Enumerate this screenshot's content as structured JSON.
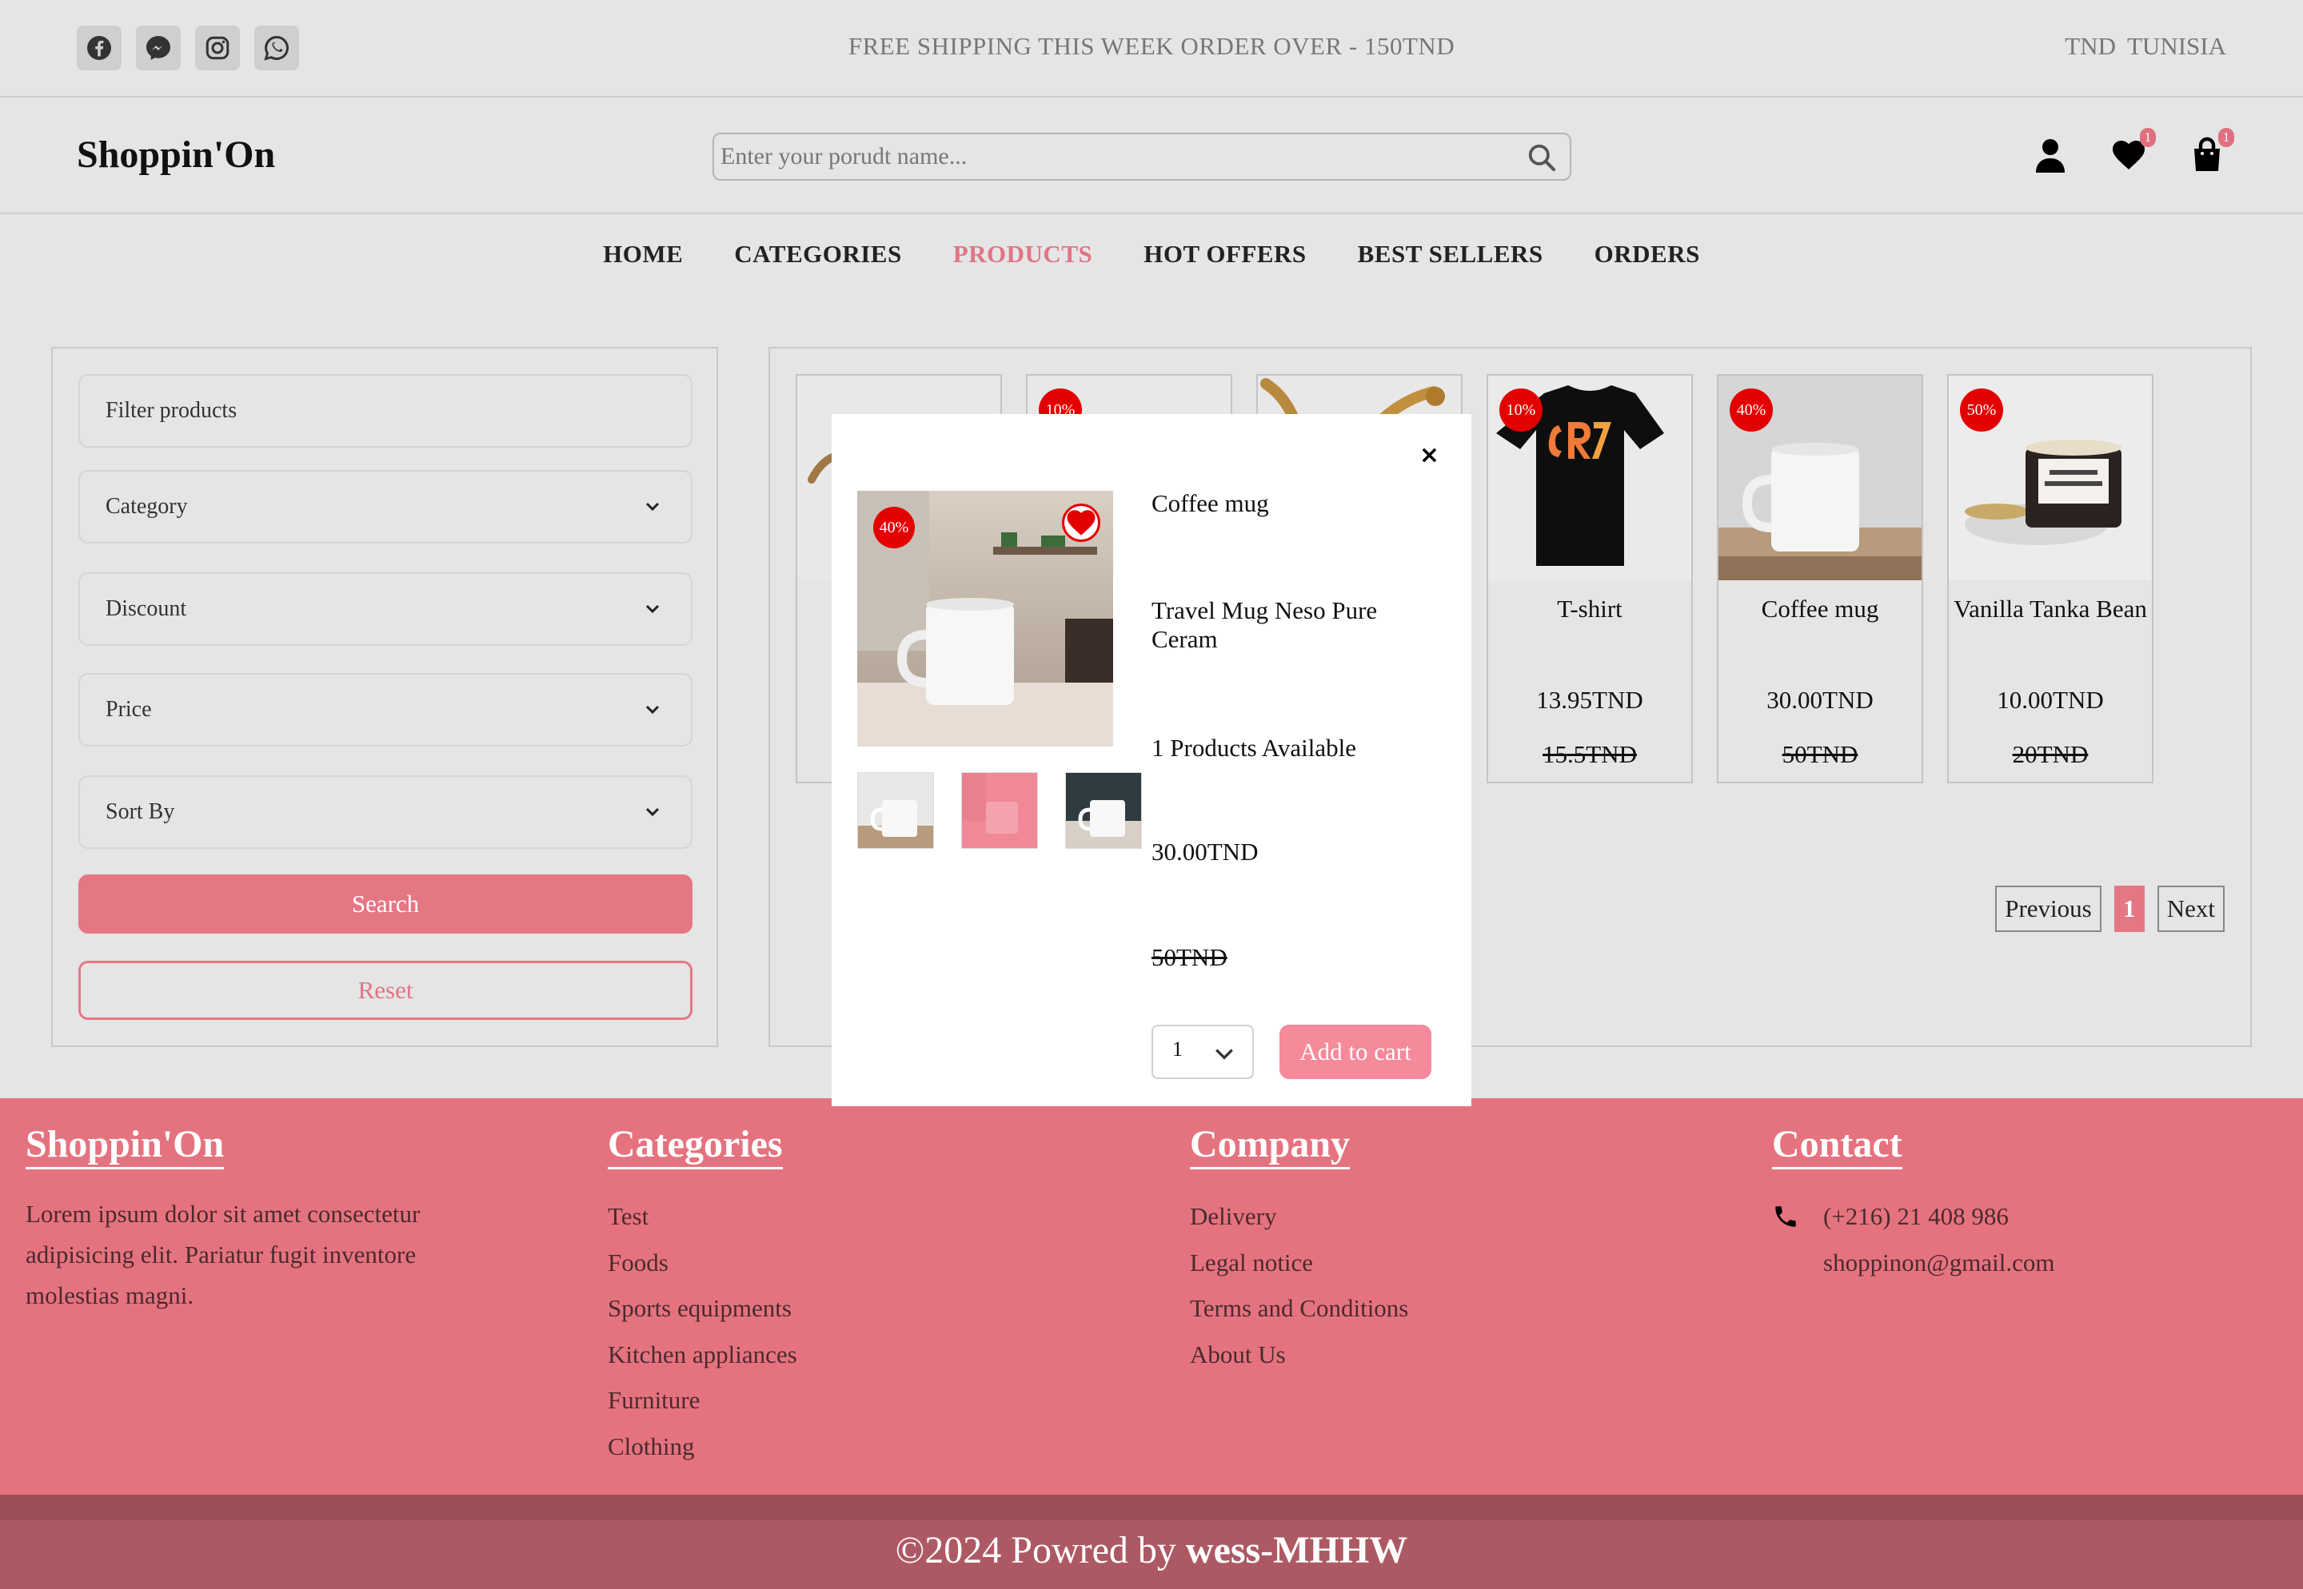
{
  "topbar": {
    "promo": "FREE SHIPPING THIS WEEK ORDER OVER - 150TND",
    "currency": "TND",
    "country": "TUNISIA"
  },
  "header": {
    "brand": "Shoppin'On",
    "search_placeholder": "Enter your porudt name...",
    "wishlist_count": "1",
    "cart_count": "1"
  },
  "nav": {
    "items": [
      "HOME",
      "CATEGORIES",
      "PRODUCTS",
      "HOT OFFERS",
      "BEST SELLERS",
      "ORDERS"
    ],
    "active": "PRODUCTS"
  },
  "filter": {
    "title": "Filter products",
    "category": "Category",
    "discount": "Discount",
    "price": "Price",
    "sort": "Sort By",
    "search_label": "Search",
    "reset_label": "Reset"
  },
  "products": [
    {
      "name": "",
      "price": "",
      "old_price": "",
      "discount": ""
    },
    {
      "name": "",
      "price": "",
      "old_price": "",
      "discount": "10%"
    },
    {
      "name": "",
      "price": "",
      "old_price": "",
      "discount": ""
    },
    {
      "name": "T-shirt",
      "price": "13.95TND",
      "old_price": "15.5TND",
      "discount": "10%"
    },
    {
      "name": "Coffee mug",
      "price": "30.00TND",
      "old_price": "50TND",
      "discount": "40%"
    },
    {
      "name": "Vanilla Tanka Bean",
      "price": "10.00TND",
      "old_price": "20TND",
      "discount": "50%"
    }
  ],
  "pager": {
    "previous": "Previous",
    "current": "1",
    "next": "Next"
  },
  "modal": {
    "close": "×",
    "discount": "40%",
    "name": "Coffee mug",
    "description": "Travel Mug Neso Pure Ceram",
    "availability": "1 Products Available",
    "price": "30.00TND",
    "old_price": "50TND",
    "quantity": "1",
    "add_to_cart": "Add to cart"
  },
  "footer": {
    "brand": {
      "title": "Shoppin'On",
      "text": "Lorem ipsum dolor sit amet consectetur adipisicing elit. Pariatur fugit inventore molestias magni."
    },
    "categories": {
      "title": "Categories",
      "items": [
        "Test",
        "Foods",
        "Sports equipments",
        "Kitchen appliances",
        "Furniture",
        "Clothing"
      ]
    },
    "company": {
      "title": "Company",
      "items": [
        "Delivery",
        "Legal notice",
        "Terms and Conditions",
        "About Us"
      ]
    },
    "contact": {
      "title": "Contact",
      "phone": "(+216) 21 408 986",
      "email": "shoppinon@gmail.com"
    },
    "copyright_prefix": "©2024 Powred by ",
    "copyright_author": "wess-MHHW"
  },
  "colors": {
    "accent": "#e57785",
    "footer": "#e5737f",
    "discount": "#e30000"
  }
}
